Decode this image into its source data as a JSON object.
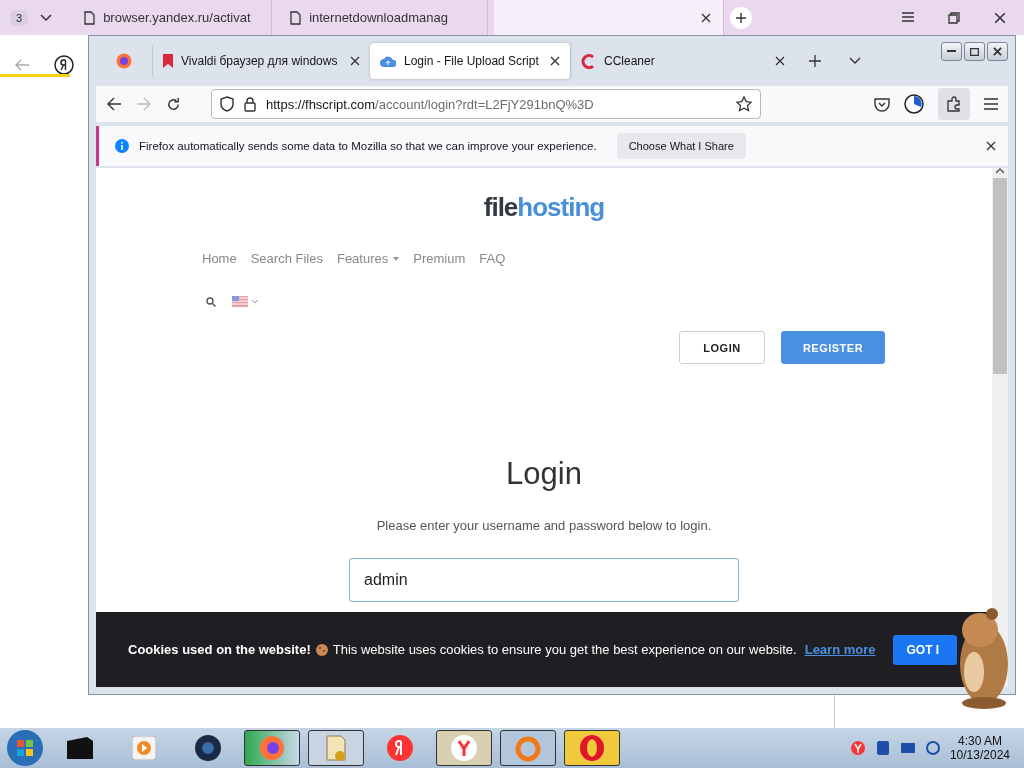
{
  "back_window": {
    "tab_counter": "3",
    "tabs": [
      {
        "title": "browser.yandex.ru/activat",
        "selected": false
      },
      {
        "title": "internetdownloadmanag",
        "selected": false
      },
      {
        "selected": true
      }
    ]
  },
  "browser": {
    "tabs": [
      {
        "title": "Vivaldi браузер для windows",
        "selected": false
      },
      {
        "title": "Login - File Upload Script",
        "selected": true
      },
      {
        "title": "CCleaner",
        "selected": false
      }
    ],
    "url": {
      "host": "https://fhscript.com",
      "path": "/account/login?rdt=L2FjY291bnQ%3D"
    },
    "notification": {
      "message": "Firefox automatically sends some data to Mozilla so that we can improve your experience.",
      "button": "Choose What I Share"
    }
  },
  "site": {
    "logo": {
      "part_1": "file",
      "part_2": "hosting"
    },
    "nav": [
      {
        "label": "Home",
        "dropdown": false
      },
      {
        "label": "Search Files",
        "dropdown": false
      },
      {
        "label": "Features",
        "dropdown": true
      },
      {
        "label": "Premium",
        "dropdown": false
      },
      {
        "label": "FAQ",
        "dropdown": false
      }
    ],
    "buttons": [
      {
        "label": "LOGIN",
        "kind": "outline"
      },
      {
        "label": "REGISTER",
        "kind": "primary"
      }
    ],
    "heading": "Login",
    "intro": "Please enter your username and password below to login.",
    "username": "admin"
  },
  "cookie_banner": {
    "title": "Cookies used on the website!",
    "message": "This website uses cookies to ensure you get the best experience on our website.",
    "link": "Learn more",
    "button": "GOT I"
  },
  "taskbar": {
    "time": "4:30 AM",
    "date": "10/13/2024"
  }
}
